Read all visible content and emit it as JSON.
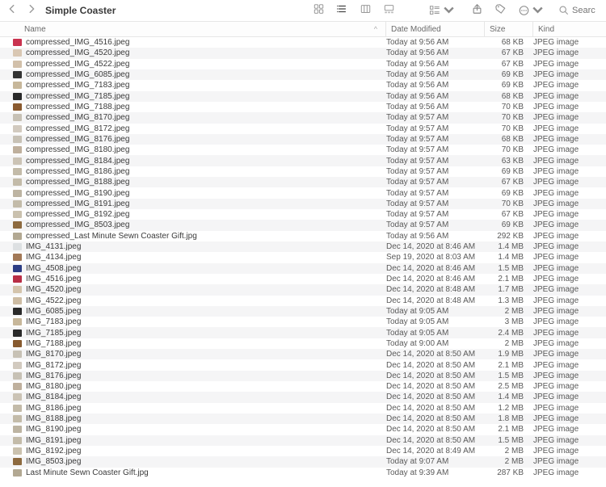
{
  "window": {
    "title": "Simple Coaster"
  },
  "search": {
    "placeholder": "Searc"
  },
  "columns": {
    "name": "Name",
    "date": "Date Modified",
    "size": "Size",
    "kind": "Kind"
  },
  "sort_indicator": "^",
  "toolbar_icons": {
    "back": "chevron-left-icon",
    "forward": "chevron-right-icon",
    "icons_view": "grid-icon",
    "list_view": "list-icon",
    "columns_view": "columns-icon",
    "gallery_view": "gallery-icon",
    "group": "group-icon",
    "share": "share-icon",
    "tag": "tag-icon",
    "more": "more-icon",
    "search": "search-icon"
  },
  "files": [
    {
      "name": "compressed_IMG_4516.jpeg",
      "date": "Today at 9:56 AM",
      "size": "68 KB",
      "kind": "JPEG image",
      "thumb": "#c9334f"
    },
    {
      "name": "compressed_IMG_4520.jpeg",
      "date": "Today at 9:56 AM",
      "size": "67 KB",
      "kind": "JPEG image",
      "thumb": "#d9c7b3"
    },
    {
      "name": "compressed_IMG_4522.jpeg",
      "date": "Today at 9:56 AM",
      "size": "67 KB",
      "kind": "JPEG image",
      "thumb": "#d2c0aa"
    },
    {
      "name": "compressed_IMG_6085.jpeg",
      "date": "Today at 9:56 AM",
      "size": "69 KB",
      "kind": "JPEG image",
      "thumb": "#333"
    },
    {
      "name": "compressed_IMG_7183.jpeg",
      "date": "Today at 9:56 AM",
      "size": "69 KB",
      "kind": "JPEG image",
      "thumb": "#c7b79a"
    },
    {
      "name": "compressed_IMG_7185.jpeg",
      "date": "Today at 9:56 AM",
      "size": "68 KB",
      "kind": "JPEG image",
      "thumb": "#2a2a2a"
    },
    {
      "name": "compressed_IMG_7188.jpeg",
      "date": "Today at 9:56 AM",
      "size": "70 KB",
      "kind": "JPEG image",
      "thumb": "#8a5a2f"
    },
    {
      "name": "compressed_IMG_8170.jpeg",
      "date": "Today at 9:57 AM",
      "size": "70 KB",
      "kind": "JPEG image",
      "thumb": "#c7c1b5"
    },
    {
      "name": "compressed_IMG_8172.jpeg",
      "date": "Today at 9:57 AM",
      "size": "70 KB",
      "kind": "JPEG image",
      "thumb": "#d2cabf"
    },
    {
      "name": "compressed_IMG_8176.jpeg",
      "date": "Today at 9:57 AM",
      "size": "68 KB",
      "kind": "JPEG image",
      "thumb": "#c7c1b5"
    },
    {
      "name": "compressed_IMG_8180.jpeg",
      "date": "Today at 9:57 AM",
      "size": "70 KB",
      "kind": "JPEG image",
      "thumb": "#bfb09d"
    },
    {
      "name": "compressed_IMG_8184.jpeg",
      "date": "Today at 9:57 AM",
      "size": "63 KB",
      "kind": "JPEG image",
      "thumb": "#cbc3b5"
    },
    {
      "name": "compressed_IMG_8186.jpeg",
      "date": "Today at 9:57 AM",
      "size": "69 KB",
      "kind": "JPEG image",
      "thumb": "#c3bba9"
    },
    {
      "name": "compressed_IMG_8188.jpeg",
      "date": "Today at 9:57 AM",
      "size": "67 KB",
      "kind": "JPEG image",
      "thumb": "#c3bba9"
    },
    {
      "name": "compressed_IMG_8190.jpeg",
      "date": "Today at 9:57 AM",
      "size": "69 KB",
      "kind": "JPEG image",
      "thumb": "#bdb4a2"
    },
    {
      "name": "compressed_IMG_8191.jpeg",
      "date": "Today at 9:57 AM",
      "size": "70 KB",
      "kind": "JPEG image",
      "thumb": "#c3bba9"
    },
    {
      "name": "compressed_IMG_8192.jpeg",
      "date": "Today at 9:57 AM",
      "size": "67 KB",
      "kind": "JPEG image",
      "thumb": "#cac1ae"
    },
    {
      "name": "compressed_IMG_8503.jpeg",
      "date": "Today at 9:57 AM",
      "size": "69 KB",
      "kind": "JPEG image",
      "thumb": "#8d6a3f"
    },
    {
      "name": "compressed_Last Minute Sewn Coaster Gift.jpg",
      "date": "Today at 9:56 AM",
      "size": "292 KB",
      "kind": "JPEG image",
      "thumb": "#b2a892"
    },
    {
      "name": "IMG_4131.jpeg",
      "date": "Dec 14, 2020 at 8:46 AM",
      "size": "1.4 MB",
      "kind": "JPEG image",
      "thumb": "#dde0e2"
    },
    {
      "name": "IMG_4134.jpeg",
      "date": "Sep 19, 2020 at 8:03 AM",
      "size": "1.4 MB",
      "kind": "JPEG image",
      "thumb": "#a27856"
    },
    {
      "name": "IMG_4508.jpeg",
      "date": "Dec 14, 2020 at 8:46 AM",
      "size": "1.5 MB",
      "kind": "JPEG image",
      "thumb": "#2d3d84"
    },
    {
      "name": "IMG_4516.jpeg",
      "date": "Dec 14, 2020 at 8:46 AM",
      "size": "2.1 MB",
      "kind": "JPEG image",
      "thumb": "#b82e45"
    },
    {
      "name": "IMG_4520.jpeg",
      "date": "Dec 14, 2020 at 8:48 AM",
      "size": "1.7 MB",
      "kind": "JPEG image",
      "thumb": "#d4c4ac"
    },
    {
      "name": "IMG_4522.jpeg",
      "date": "Dec 14, 2020 at 8:48 AM",
      "size": "1.3 MB",
      "kind": "JPEG image",
      "thumb": "#cdbca3"
    },
    {
      "name": "IMG_6085.jpeg",
      "date": "Today at 9:05 AM",
      "size": "2 MB",
      "kind": "JPEG image",
      "thumb": "#2a2a2a"
    },
    {
      "name": "IMG_7183.jpeg",
      "date": "Today at 9:05 AM",
      "size": "3 MB",
      "kind": "JPEG image",
      "thumb": "#c7b79a"
    },
    {
      "name": "IMG_7185.jpeg",
      "date": "Today at 9:05 AM",
      "size": "2.4 MB",
      "kind": "JPEG image",
      "thumb": "#2a2a2a"
    },
    {
      "name": "IMG_7188.jpeg",
      "date": "Today at 9:00 AM",
      "size": "2 MB",
      "kind": "JPEG image",
      "thumb": "#875a2f"
    },
    {
      "name": "IMG_8170.jpeg",
      "date": "Dec 14, 2020 at 8:50 AM",
      "size": "1.9 MB",
      "kind": "JPEG image",
      "thumb": "#c7c1b5"
    },
    {
      "name": "IMG_8172.jpeg",
      "date": "Dec 14, 2020 at 8:50 AM",
      "size": "2.1 MB",
      "kind": "JPEG image",
      "thumb": "#d2cabf"
    },
    {
      "name": "IMG_8176.jpeg",
      "date": "Dec 14, 2020 at 8:50 AM",
      "size": "1.5 MB",
      "kind": "JPEG image",
      "thumb": "#c7c1b5"
    },
    {
      "name": "IMG_8180.jpeg",
      "date": "Dec 14, 2020 at 8:50 AM",
      "size": "2.5 MB",
      "kind": "JPEG image",
      "thumb": "#bfb09d"
    },
    {
      "name": "IMG_8184.jpeg",
      "date": "Dec 14, 2020 at 8:50 AM",
      "size": "1.4 MB",
      "kind": "JPEG image",
      "thumb": "#cbc3b5"
    },
    {
      "name": "IMG_8186.jpeg",
      "date": "Dec 14, 2020 at 8:50 AM",
      "size": "1.2 MB",
      "kind": "JPEG image",
      "thumb": "#c3bba9"
    },
    {
      "name": "IMG_8188.jpeg",
      "date": "Dec 14, 2020 at 8:50 AM",
      "size": "1.8 MB",
      "kind": "JPEG image",
      "thumb": "#c3bba9"
    },
    {
      "name": "IMG_8190.jpeg",
      "date": "Dec 14, 2020 at 8:50 AM",
      "size": "2.1 MB",
      "kind": "JPEG image",
      "thumb": "#bdb4a2"
    },
    {
      "name": "IMG_8191.jpeg",
      "date": "Dec 14, 2020 at 8:50 AM",
      "size": "1.5 MB",
      "kind": "JPEG image",
      "thumb": "#c3bba9"
    },
    {
      "name": "IMG_8192.jpeg",
      "date": "Dec 14, 2020 at 8:49 AM",
      "size": "2 MB",
      "kind": "JPEG image",
      "thumb": "#cac1ae"
    },
    {
      "name": "IMG_8503.jpeg",
      "date": "Today at 9:07 AM",
      "size": "2 MB",
      "kind": "JPEG image",
      "thumb": "#8d6a3f"
    },
    {
      "name": "Last Minute Sewn Coaster Gift.jpg",
      "date": "Today at 9:39 AM",
      "size": "287 KB",
      "kind": "JPEG image",
      "thumb": "#b2a892"
    }
  ]
}
